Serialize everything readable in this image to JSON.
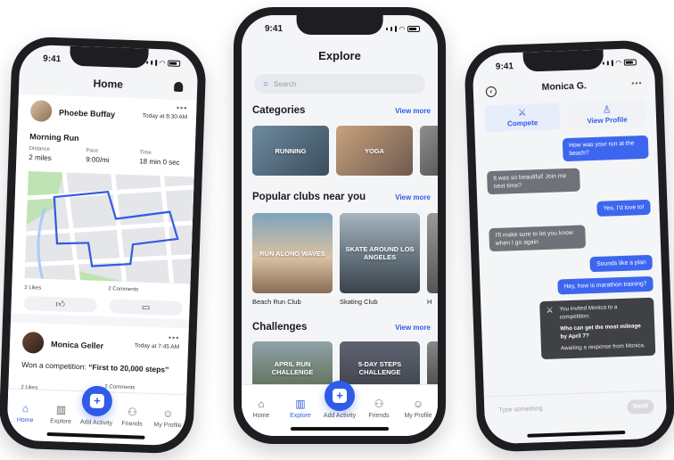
{
  "status": {
    "time": "9:41"
  },
  "home": {
    "title": "Home",
    "posts": [
      {
        "user": "Phoebe Buffay",
        "timestamp": "Today at 8:30 AM",
        "activity": "Morning Run",
        "stats": [
          {
            "label": "Distance",
            "value": "2 miles"
          },
          {
            "label": "Pace",
            "value": "9:00/mi"
          },
          {
            "label": "Time",
            "value": "18 min 0 sec"
          }
        ],
        "likes": "2 Likes",
        "comments": "2 Comments"
      },
      {
        "user": "Monica Geller",
        "timestamp": "Today at 7:45 AM",
        "text_prefix": "Won a competition: ",
        "text_highlight": "“First to 20,000 steps”",
        "likes": "2 Likes",
        "comments": "2 Comments"
      }
    ]
  },
  "tabs": [
    {
      "label": "Home",
      "icon": "home-icon"
    },
    {
      "label": "Explore",
      "icon": "explore-icon"
    },
    {
      "label": "Add Activity",
      "icon": "plus-icon"
    },
    {
      "label": "Friends",
      "icon": "friends-icon"
    },
    {
      "label": "My Profile",
      "icon": "profile-icon"
    }
  ],
  "explore": {
    "title": "Explore",
    "search_placeholder": "Search",
    "view_more": "View more",
    "categories_heading": "Categories",
    "categories": [
      "RUNNING",
      "YOGA"
    ],
    "clubs_heading": "Popular clubs near you",
    "clubs": [
      {
        "banner": "RUN ALONG WAVES",
        "name": "Beach Run Club"
      },
      {
        "banner": "SKATE AROUND LOS ANGELES",
        "name": "Skating Club"
      },
      {
        "banner": "",
        "name": "H"
      }
    ],
    "challenges_heading": "Challenges",
    "challenges": [
      "APRIL RUN CHALLENGE",
      "5-DAY STEPS CHALLENGE"
    ]
  },
  "chat": {
    "contact": "Monica G.",
    "compete_label": "Compete",
    "view_profile_label": "View Profile",
    "messages": [
      {
        "from": "me",
        "text": "How was your run at the beach?"
      },
      {
        "from": "them",
        "text": "It was so beautiful! Join me next time?"
      },
      {
        "from": "me",
        "text": "Yes, I’d love to!"
      },
      {
        "from": "them",
        "text": "I’ll make sure to let you know when I go again"
      },
      {
        "from": "me",
        "text": "Sounds like a plan"
      },
      {
        "from": "me",
        "text": "Hey, how is marathon training?"
      }
    ],
    "invite": {
      "line1": "You invited Monica to a competition:",
      "question": "Who can get the most mileage by April 7?",
      "status": "Awaiting a response from Monica."
    },
    "input_placeholder": "Type something",
    "send_label": "Send"
  },
  "colors": {
    "accent": "#2f5be7",
    "bubble_out": "#3d66ef",
    "bubble_in": "#6f7278"
  }
}
